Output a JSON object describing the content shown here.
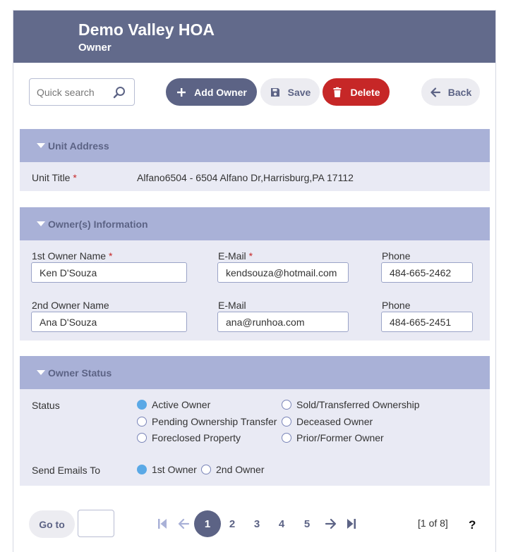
{
  "header": {
    "title": "Demo Valley HOA",
    "subtitle": "Owner"
  },
  "toolbar": {
    "search_placeholder": "Quick search",
    "add_label": "Add Owner",
    "save_label": "Save",
    "delete_label": "Delete",
    "back_label": "Back"
  },
  "unit_address": {
    "title": "Unit Address",
    "unit_title_label": "Unit Title",
    "required_mark": "*",
    "unit_title_value": "Alfano6504 - 6504 Alfano Dr,Harrisburg,PA 17112"
  },
  "owners": {
    "title": "Owner(s) Information",
    "first_name_label": "1st Owner Name",
    "first_name_value": "Ken D'Souza",
    "first_email_label": "E-Mail",
    "first_email_value": "kendsouza@hotmail.com",
    "first_phone_label": "Phone",
    "first_phone_value": "484-665-2462",
    "second_name_label": "2nd Owner Name",
    "second_name_value": "Ana D'Souza",
    "second_email_label": "E-Mail",
    "second_email_value": "ana@runhoa.com",
    "second_phone_label": "Phone",
    "second_phone_value": "484-665-2451",
    "required_mark": "*"
  },
  "status": {
    "title": "Owner Status",
    "status_label": "Status",
    "options": [
      "Active Owner",
      "Sold/Transferred Ownership",
      "Pending Ownership Transfer",
      "Deceased Owner",
      "Foreclosed Property",
      "Prior/Former Owner"
    ],
    "selected": "Active Owner",
    "send_label": "Send Emails To",
    "send_options": [
      "1st Owner",
      "2nd Owner"
    ],
    "send_selected": "1st Owner"
  },
  "pager": {
    "goto_label": "Go to",
    "pages": [
      "1",
      "2",
      "3",
      "4",
      "5"
    ],
    "current": "1",
    "info": "[1 of 8]",
    "help": "?"
  },
  "colors": {
    "header": "#626a8b",
    "section": "#a9b1d7",
    "primary": "#5c6385",
    "danger": "#c62727",
    "radio_on": "#5aa9e6"
  }
}
